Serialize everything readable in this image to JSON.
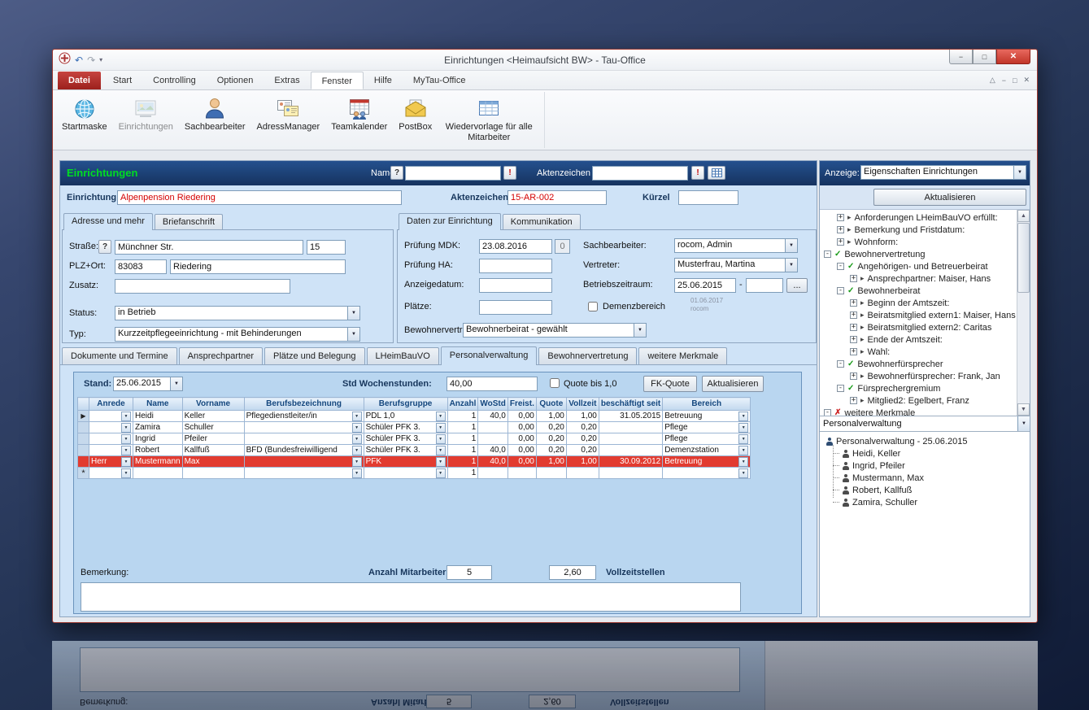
{
  "window": {
    "title": "Einrichtungen <Heimaufsicht BW>  - Tau-Office",
    "qat": {
      "undo": "↶",
      "redo": "↷",
      "menu_arrow": "▾"
    },
    "controls": {
      "minimize": "−",
      "maximize": "□",
      "close": "✕"
    },
    "ribbon_right": {
      "collapse": "△",
      "minimize": "−",
      "restore": "□",
      "close": "✕"
    }
  },
  "icons": {
    "dropdown_arrow": "▼",
    "scroll_up": "▲",
    "scroll_down": "▼"
  },
  "ribbon": {
    "file_tab": "Datei",
    "tabs": [
      "Start",
      "Controlling",
      "Optionen",
      "Extras",
      "Fenster",
      "Hilfe",
      "MyTau-Office"
    ],
    "buttons": [
      {
        "label": "Startmaske"
      },
      {
        "label": "Einrichtungen"
      },
      {
        "label": "Sachbearbeiter"
      },
      {
        "label": "AdressManager"
      },
      {
        "label": "Teamkalender"
      },
      {
        "label": "PostBox"
      },
      {
        "label": "Wiedervorlage für alle Mitarbeiter"
      }
    ]
  },
  "header": {
    "title": "Einrichtungen",
    "name_label": "Name",
    "help_button": "?",
    "name_value": "",
    "name_go_button": "!",
    "akz_label": "Aktenzeichen",
    "akz_value": "",
    "akz_go_button": "!"
  },
  "record": {
    "einrichtung_label": "Einrichtung",
    "einrichtung_value": "Alpenpension Riedering",
    "akz_label": "Aktenzeichen",
    "akz_value": "15-AR-002",
    "kuerzel_label": "Kürzel",
    "kuerzel_value": ""
  },
  "address_group": {
    "tabs": [
      "Adresse und mehr",
      "Briefanschrift"
    ],
    "strasse_label": "Straße:",
    "strasse_help": "?",
    "strasse_value": "Münchner Str.",
    "hausnr_value": "15",
    "plz_label": "PLZ+Ort:",
    "plz_value": "83083",
    "ort_value": "Riedering",
    "zusatz_label": "Zusatz:",
    "zusatz_value": "",
    "status_label": "Status:",
    "status_value": "in Betrieb",
    "typ_label": "Typ:",
    "typ_value": "Kurzzeitpflegeeinrichtung  - mit Behinderungen"
  },
  "daten_group": {
    "tabs": [
      "Daten zur Einrichtung",
      "Kommunikation"
    ],
    "mdk_label": "Prüfung MDK:",
    "mdk_value": "23.08.2016",
    "mdk_count": "0",
    "ha_label": "Prüfung HA:",
    "ha_value": "",
    "anzeigedatum_label": "Anzeigedatum:",
    "anzeigedatum_value": "",
    "plaetze_label": "Plätze:",
    "plaetze_value": "",
    "demenz_label": "Demenzbereich",
    "demenz_note_line1": "01.06.2017",
    "demenz_note_line2": "rocom",
    "bewohnervertr_label": "Bewohnervertr",
    "bewohnervertr_value": "Bewohnerbeirat  - gewählt",
    "sachbearbeiter_label": "Sachbearbeiter:",
    "sachbearbeiter_value": "rocom, Admin",
    "vertreter_label": "Vertreter:",
    "vertreter_value": "Musterfrau, Martina",
    "betriebszeitraum_label": "Betriebszeitraum:",
    "betriebszeitraum_von": "25.06.2015",
    "betriebszeitraum_sep": "-",
    "betriebszeitraum_bis": "",
    "ellipsis_button": "..."
  },
  "detail_tabs": [
    "Dokumente und Termine",
    "Ansprechpartner",
    "Plätze und Belegung",
    "LHeimBauVO",
    "Personalverwaltung",
    "Bewohnervertretung",
    "weitere Merkmale"
  ],
  "personal": {
    "stand_label": "Stand:",
    "stand_value": "25.06.2015",
    "wochenstunden_label": "Std Wochenstunden:",
    "wochenstunden_value": "40,00",
    "quote_checkbox_label": "Quote bis 1,0",
    "fk_quote_button": "FK-Quote",
    "aktualisieren_button": "Aktualisieren",
    "columns": [
      "Anrede",
      "Name",
      "Vorname",
      "Berufsbezeichnung",
      "Berufsgruppe",
      "Anzahl",
      "WoStd",
      "Freist.",
      "Quote",
      "Vollzeit",
      "beschäftigt seit",
      "Bereich"
    ],
    "rows": [
      {
        "sel": "▶",
        "anrede": "",
        "name": "Heidi",
        "vorname": "Keller",
        "beruf": "Pflegedienstleiter/in",
        "gruppe": "PDL 1,0",
        "anzahl": "1",
        "wostd": "40,0",
        "freist": "0,00",
        "quote": "1,00",
        "vollzeit": "1,00",
        "seit": "31.05.2015",
        "bereich": "Betreuung"
      },
      {
        "sel": "",
        "anrede": "",
        "name": "Zamira",
        "vorname": "Schuller",
        "beruf": "",
        "gruppe": "Schüler PFK 3.",
        "anzahl": "1",
        "wostd": "",
        "freist": "0,00",
        "quote": "0,20",
        "vollzeit": "0,20",
        "seit": "",
        "bereich": "Pflege"
      },
      {
        "sel": "",
        "anrede": "",
        "name": "Ingrid",
        "vorname": "Pfeiler",
        "beruf": "",
        "gruppe": "Schüler PFK 3.",
        "anzahl": "1",
        "wostd": "",
        "freist": "0,00",
        "quote": "0,20",
        "vollzeit": "0,20",
        "seit": "",
        "bereich": "Pflege"
      },
      {
        "sel": "",
        "anrede": "",
        "name": "Robert",
        "vorname": "Kallfuß",
        "beruf": "BFD (Bundesfreiwilligend",
        "gruppe": "Schüler PFK 3.",
        "anzahl": "1",
        "wostd": "40,0",
        "freist": "0,00",
        "quote": "0,20",
        "vollzeit": "0,20",
        "seit": "",
        "bereich": "Demenzstation"
      },
      {
        "sel": "",
        "anrede": "Herr",
        "name": "Mustermann",
        "vorname": "Max",
        "beruf": "",
        "gruppe": "PFK",
        "anzahl": "1",
        "wostd": "40,0",
        "freist": "0,00",
        "quote": "1,00",
        "vollzeit": "1,00",
        "seit": "30.09.2012",
        "bereich": "Betreuung"
      },
      {
        "sel": "*",
        "anrede": "",
        "name": "",
        "vorname": "",
        "beruf": "",
        "gruppe": "",
        "anzahl": "1",
        "wostd": "",
        "freist": "",
        "quote": "",
        "vollzeit": "",
        "seit": "",
        "bereich": ""
      }
    ],
    "bemerkung_label": "Bemerkung:",
    "bemerkung_value": "",
    "anzahl_label": "Anzahl Mitarbeiter:",
    "anzahl_value": "5",
    "vollzeit_value": "2,60",
    "vollzeit_label": "Vollzeitstellen"
  },
  "right_panel": {
    "anzeige_label": "Anzeige:",
    "anzeige_value": "Eigenschaften Einrichtungen",
    "aktualisieren_button": "Aktualisieren",
    "tree": [
      {
        "expand": "+",
        "mark": "▸",
        "label": "Anforderungen LHeimBauVO erfüllt:"
      },
      {
        "expand": "+",
        "mark": "▸",
        "label": "Bemerkung und Fristdatum:"
      },
      {
        "expand": "+",
        "mark": "▸",
        "label": "Wohnform:"
      },
      {
        "expand": "-",
        "mark": "✓",
        "label": "Bewohnervertretung"
      },
      {
        "expand": "-",
        "mark": "✓",
        "label": "Angehörigen- und Betreuerbeirat"
      },
      {
        "expand": "+",
        "mark": "▸",
        "label": "Ansprechpartner: Maiser, Hans"
      },
      {
        "expand": "-",
        "mark": "✓",
        "label": "Bewohnerbeirat"
      },
      {
        "expand": "+",
        "mark": "▸",
        "label": "Beginn der Amtszeit:"
      },
      {
        "expand": "+",
        "mark": "▸",
        "label": "Beiratsmitglied extern1: Maiser, Hans"
      },
      {
        "expand": "+",
        "mark": "▸",
        "label": "Beiratsmitglied extern2: Caritas"
      },
      {
        "expand": "+",
        "mark": "▸",
        "label": "Ende der Amtszeit:"
      },
      {
        "expand": "+",
        "mark": "▸",
        "label": "Wahl:"
      },
      {
        "expand": "-",
        "mark": "✓",
        "label": "Bewohnerfürsprecher"
      },
      {
        "expand": "+",
        "mark": "▸",
        "label": "Bewohnerfürsprecher: Frank, Jan"
      },
      {
        "expand": "-",
        "mark": "✓",
        "label": "Fürsprechergremium"
      },
      {
        "expand": "+",
        "mark": "▸",
        "label": "Mitglied2: Egelbert, Franz"
      },
      {
        "expand": "-",
        "mark": "✗",
        "label": "weitere Merkmale"
      }
    ],
    "personal_combo": "Personalverwaltung",
    "personal_tree_root": "Personalverwaltung - 25.06.2015",
    "personal_tree_items": [
      "Heidi, Keller",
      "Ingrid, Pfeiler",
      "Mustermann, Max",
      "Robert, Kallfuß",
      "Zamira, Schuller"
    ]
  },
  "colors": {
    "title_green": "#00dd22",
    "value_red": "#d40000",
    "selected_row_red": "#e23b30",
    "header_navy": "#16335f",
    "file_tab_red": "#9c201c"
  }
}
